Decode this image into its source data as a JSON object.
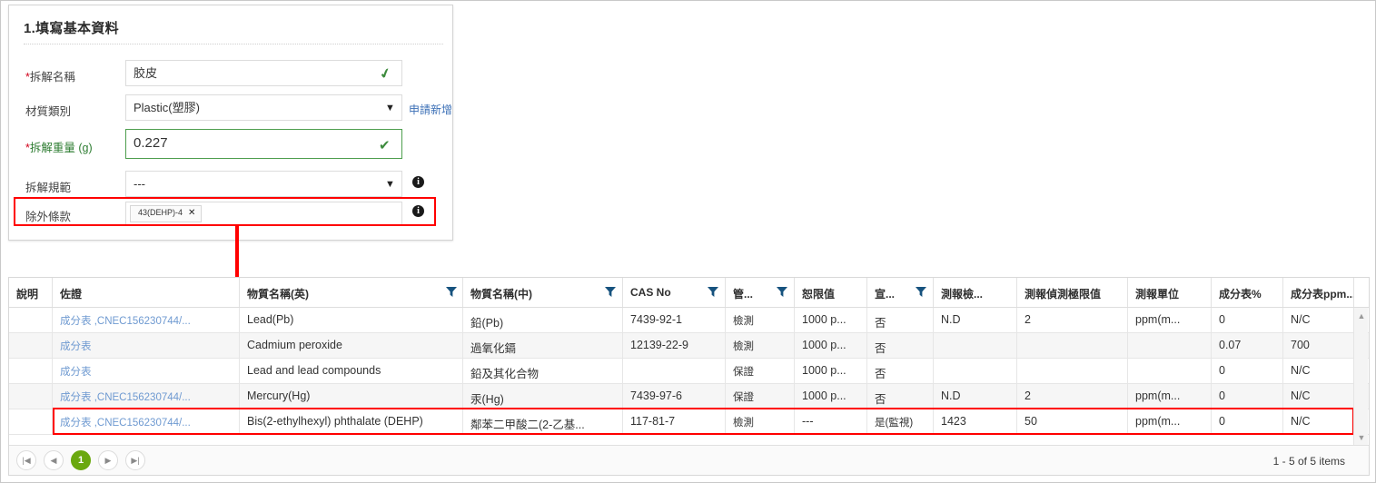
{
  "form": {
    "title": "1.填寫基本資料",
    "rows": [
      {
        "label": "*拆解名稱",
        "required": true,
        "value": "胶皮",
        "kind": "text",
        "valid": true
      },
      {
        "label": "材質類別",
        "required": false,
        "value": "Plastic(塑膠)",
        "kind": "select",
        "link": "申請新增"
      },
      {
        "label": "*拆解重量 (g)",
        "required": true,
        "value": "0.227",
        "kind": "text",
        "valid": true,
        "emphasis": true
      },
      {
        "label": "拆解規範",
        "required": false,
        "value": "---",
        "kind": "select",
        "info": true
      },
      {
        "label": "除外條款",
        "required": false,
        "kind": "tags",
        "info": true,
        "tags": [
          {
            "text": "43(DEHP)-4",
            "remove": "✕"
          }
        ]
      }
    ],
    "info_glyph": "i",
    "caret_glyph": "▼",
    "check_glyph": "✔"
  },
  "grid": {
    "columns": [
      {
        "label": "說明",
        "filter": false
      },
      {
        "label": "佐證",
        "filter": false
      },
      {
        "label": "物質名稱(英)",
        "filter": true
      },
      {
        "label": "物質名稱(中)",
        "filter": true
      },
      {
        "label": "CAS No",
        "filter": true
      },
      {
        "label": "管...",
        "filter": true
      },
      {
        "label": "恕限值",
        "filter": false
      },
      {
        "label": "宣...",
        "filter": true
      },
      {
        "label": "測報檢...",
        "filter": false
      },
      {
        "label": "測報偵測極限值",
        "filter": false
      },
      {
        "label": "測報單位",
        "filter": false
      },
      {
        "label": "成分表%",
        "filter": false
      },
      {
        "label": "成分表ppm...",
        "filter": false
      },
      {
        "label": "",
        "filter": false
      }
    ],
    "rows": [
      {
        "highlighted": false,
        "cells": [
          "",
          "成分表 ,CNEC156230744/...",
          "Lead(Pb)",
          "鉛(Pb)",
          "7439-92-1",
          "檢測",
          "1000 p...",
          "否",
          "N.D",
          "2",
          "ppm(m...",
          "0",
          "N/C",
          ""
        ]
      },
      {
        "highlighted": false,
        "cells": [
          "",
          "成分表",
          "Cadmium peroxide",
          "過氧化鎘",
          "12139-22-9",
          "檢測",
          "1000 p...",
          "否",
          "",
          "",
          "",
          "0.07",
          "700",
          ""
        ]
      },
      {
        "highlighted": false,
        "cells": [
          "",
          "成分表",
          "Lead and lead compounds",
          "鉛及其化合物",
          "",
          "保證",
          "1000 p...",
          "否",
          "",
          "",
          "",
          "0",
          "N/C",
          ""
        ]
      },
      {
        "highlighted": false,
        "cells": [
          "",
          "成分表 ,CNEC156230744/...",
          "Mercury(Hg)",
          "汞(Hg)",
          "7439-97-6",
          "保證",
          "1000 p...",
          "否",
          "N.D",
          "2",
          "ppm(m...",
          "0",
          "N/C",
          ""
        ]
      },
      {
        "highlighted": true,
        "cells": [
          "",
          "成分表 ,CNEC156230744/...",
          "Bis(2-ethylhexyl) phthalate (DEHP)",
          "鄰苯二甲酸二(2-乙基...",
          "117-81-7",
          "檢測",
          "---",
          "是(監視)",
          "1423",
          "50",
          "ppm(m...",
          "0",
          "N/C",
          ""
        ]
      }
    ],
    "scrollbar": {
      "up": "▲",
      "down": "▼"
    },
    "pager": {
      "first": "|◀",
      "prev": "◀",
      "current": "1",
      "next": "▶",
      "last": "▶|",
      "info": "1 - 5 of 5 items"
    }
  },
  "colors": {
    "highlight": "#ff0000",
    "accent_green": "#6aa80f",
    "link_blue": "#3b6fb6",
    "valid_green": "#4d9e4d"
  }
}
